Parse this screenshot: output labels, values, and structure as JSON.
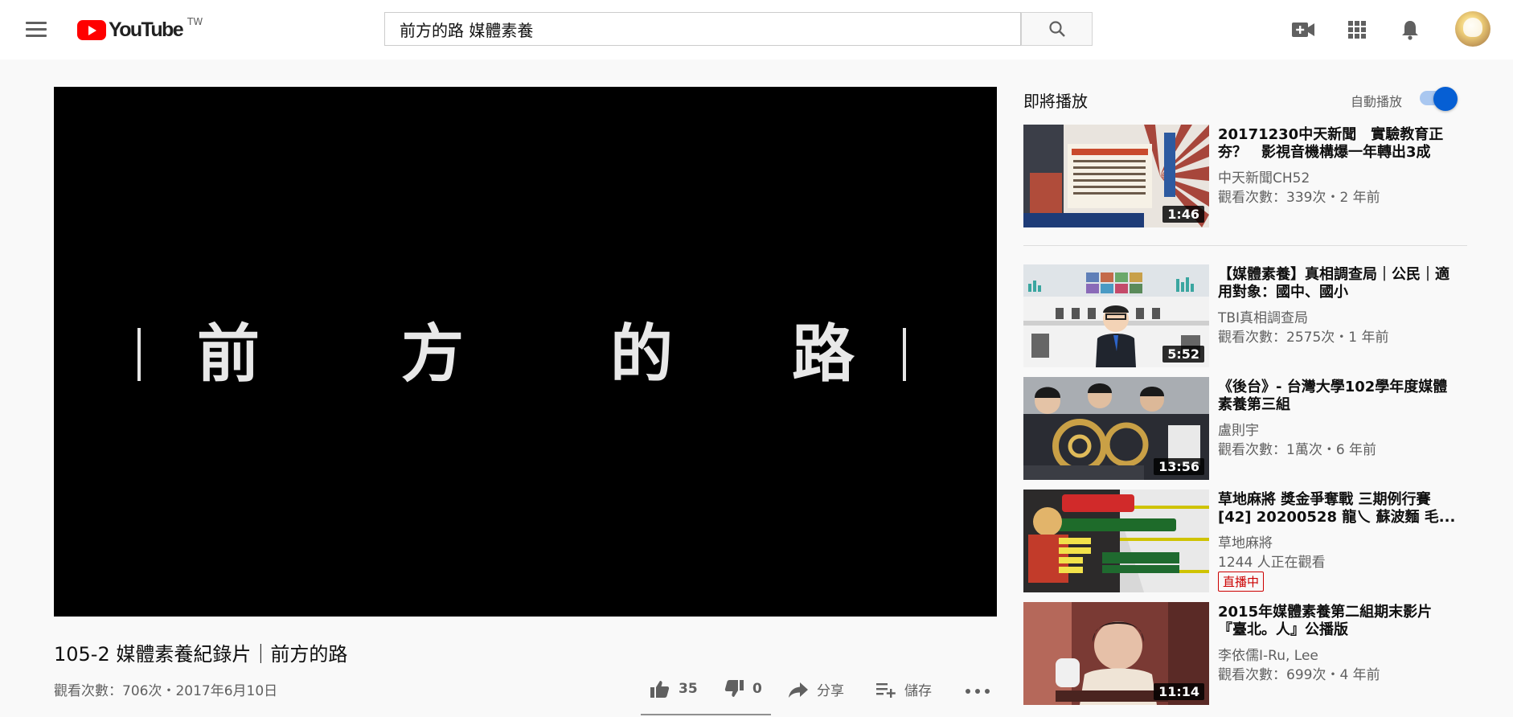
{
  "header": {
    "logo_text": "YouTube",
    "logo_region": "TW",
    "search_value": "前方的路 媒體素養",
    "icons": [
      "menu-icon",
      "search-icon",
      "video-camera-icon",
      "apps-grid-icon",
      "bell-icon"
    ]
  },
  "player": {
    "overlay_chars": [
      "前",
      "方",
      "的",
      "路"
    ]
  },
  "video": {
    "title": "105-2 媒體素養紀錄片｜前方的路",
    "meta": "觀看次數：706次・2017年6月10日",
    "likes": "35",
    "dislikes": "0",
    "share_label": "分享",
    "save_label": "儲存"
  },
  "sidebar": {
    "up_next_label": "即將播放",
    "autoplay_label": "自動播放",
    "autoplay_on": true,
    "items": [
      {
        "title": "20171230中天新聞　實驗教育正夯？　影視音機構爆一年轉出3成",
        "channel": "中天新聞CH52",
        "meta": "觀看次數：339次・2 年前",
        "duration": "1:46"
      },
      {
        "title": "【媒體素養】真相調查局｜公民｜適用對象：國中、國小",
        "channel": "TBI真相調查局",
        "meta": "觀看次數：2575次・1 年前",
        "duration": "5:52"
      },
      {
        "title": "《後台》- 台灣大學102學年度媒體素養第三組",
        "channel": "盧則宇",
        "meta": "觀看次數：1萬次・6 年前",
        "duration": "13:56"
      },
      {
        "title": "草地麻將 獎金爭奪戰 三期例行賽[42] 20200528 龍乀 蘇波麵 毛...",
        "channel": "草地麻將",
        "meta": "1244 人正在觀看",
        "live_badge": "直播中"
      },
      {
        "title": "2015年媒體素養第二組期末影片『臺北。人』公播版",
        "channel": "李依儒I-Ru, Lee",
        "meta": "觀看次數：699次・4 年前",
        "duration": "11:14"
      }
    ]
  },
  "colors": {
    "brand_red": "#ff0000",
    "accent_blue": "#065fd4",
    "live_red": "#cc0000"
  }
}
